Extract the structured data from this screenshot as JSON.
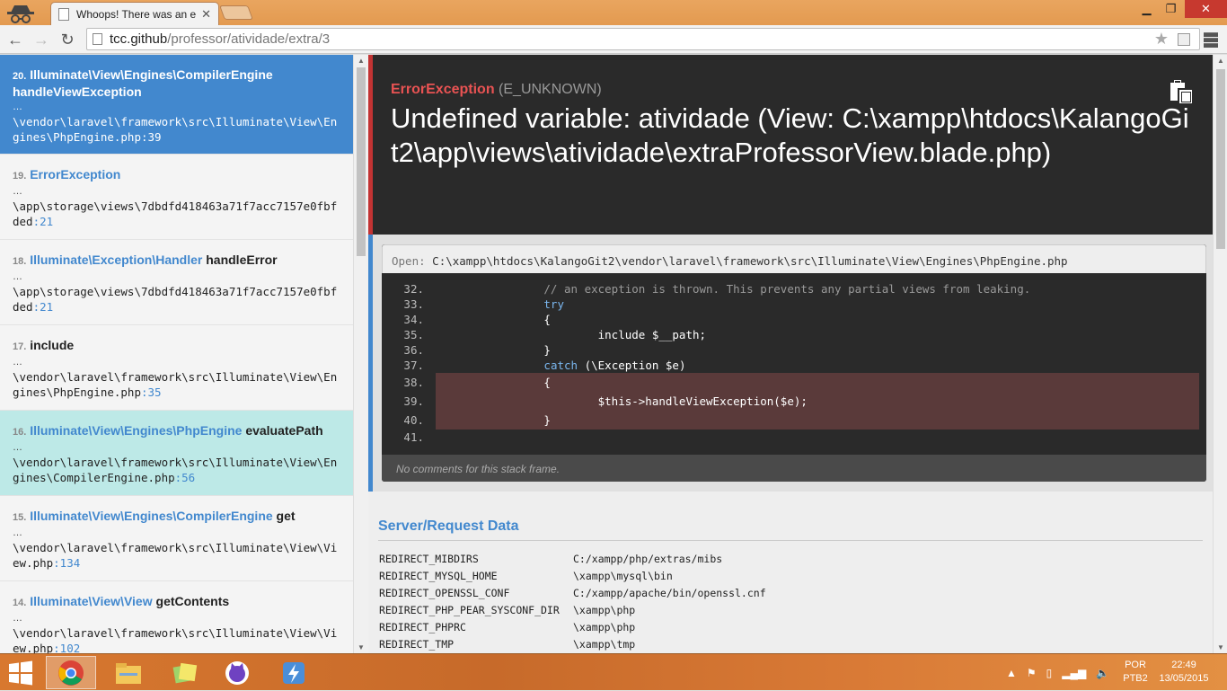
{
  "browser": {
    "tab_title": "Whoops! There was an error.",
    "url_host": "tcc.github",
    "url_path": "/professor/atividade/extra/3",
    "menu_icon": "hamburger-icon"
  },
  "frames": [
    {
      "idx": "20.",
      "cls": "Illuminate\\View\\Engines\\CompilerEngine",
      "fn": "handleViewException",
      "dots": "…",
      "file": "\\vendor\\laravel\\framework\\src\\Illuminate\\View\\Engines\\PhpEngine.php",
      "line": ":39",
      "state": "active"
    },
    {
      "idx": "19.",
      "cls": "ErrorException",
      "fn": "",
      "dots": "…",
      "file": "\\app\\storage\\views\\7dbdfd418463a71f7acc7157e0fbfded",
      "line": ":21",
      "state": ""
    },
    {
      "idx": "18.",
      "cls": "Illuminate\\Exception\\Handler",
      "fn": "handleError",
      "dots": "…",
      "file": "\\app\\storage\\views\\7dbdfd418463a71f7acc7157e0fbfded",
      "line": ":21",
      "state": ""
    },
    {
      "idx": "17.",
      "cls": "",
      "fn": "include",
      "dots": "…",
      "file": "\\vendor\\laravel\\framework\\src\\Illuminate\\View\\Engines\\PhpEngine.php",
      "line": ":35",
      "state": ""
    },
    {
      "idx": "16.",
      "cls": "Illuminate\\View\\Engines\\PhpEngine",
      "fn": "evaluatePath",
      "dots": "…",
      "file": "\\vendor\\laravel\\framework\\src\\Illuminate\\View\\Engines\\CompilerEngine.php",
      "line": ":56",
      "state": "app"
    },
    {
      "idx": "15.",
      "cls": "Illuminate\\View\\Engines\\CompilerEngine",
      "fn": "get",
      "dots": "…",
      "file": "\\vendor\\laravel\\framework\\src\\Illuminate\\View\\View.php",
      "line": ":134",
      "state": ""
    },
    {
      "idx": "14.",
      "cls": "Illuminate\\View\\View",
      "fn": "getContents",
      "dots": "…",
      "file": "\\vendor\\laravel\\framework\\src\\Illuminate\\View\\View.php",
      "line": ":102",
      "state": ""
    }
  ],
  "exception": {
    "class": "ErrorException",
    "code": "(E_UNKNOWN)",
    "message": "Undefined variable: atividade (View: C:\\xampp\\htdocs\\KalangoGit2\\app\\views\\atividade\\extraProfessorView.blade.php)"
  },
  "code": {
    "open_label": "Open:",
    "file_path": "C:\\xampp\\htdocs\\KalangoGit2\\vendor\\laravel\\framework\\src\\Illuminate\\View\\Engines\\PhpEngine.php",
    "lines": [
      {
        "n": "32.",
        "text": "                // an exception is thrown. This prevents any partial views from leaking.",
        "kind": "cmt",
        "hl": false
      },
      {
        "n": "33.",
        "text": "                try",
        "kind": "kw",
        "hl": false
      },
      {
        "n": "34.",
        "text": "                {",
        "kind": "",
        "hl": false
      },
      {
        "n": "35.",
        "text": "                        include $__path;",
        "kind": "",
        "hl": false
      },
      {
        "n": "36.",
        "text": "                }",
        "kind": "",
        "hl": false
      },
      {
        "n": "37.",
        "text": "                catch (\\Exception $e)",
        "kind": "catch",
        "hl": false
      },
      {
        "n": "38.",
        "text": "                {",
        "kind": "",
        "hl": true
      },
      {
        "n": "39.",
        "text": "                        $this->handleViewException($e);",
        "kind": "",
        "hl": true
      },
      {
        "n": "40.",
        "text": "                }",
        "kind": "",
        "hl": true
      },
      {
        "n": "41.",
        "text": "",
        "kind": "",
        "hl": false
      }
    ],
    "comments": "No comments for this stack frame."
  },
  "server": {
    "title": "Server/Request Data",
    "rows": [
      {
        "k": "REDIRECT_MIBDIRS",
        "v": "C:/xampp/php/extras/mibs"
      },
      {
        "k": "REDIRECT_MYSQL_HOME",
        "v": "\\xampp\\mysql\\bin"
      },
      {
        "k": "REDIRECT_OPENSSL_CONF",
        "v": "C:/xampp/apache/bin/openssl.cnf"
      },
      {
        "k": "REDIRECT_PHP_PEAR_SYSCONF_DIR",
        "v": "\\xampp\\php"
      },
      {
        "k": "REDIRECT_PHPRC",
        "v": "\\xampp\\php"
      },
      {
        "k": "REDIRECT_TMP",
        "v": "\\xampp\\tmp"
      }
    ]
  },
  "taskbar": {
    "lang_line1": "POR",
    "lang_line2": "PTB2",
    "time": "22:49",
    "date": "13/05/2015"
  },
  "colors": {
    "accent_blue": "#4288ce",
    "error_red": "#e95353",
    "active_frame": "#4288ce",
    "app_frame": "#bde9e7"
  }
}
